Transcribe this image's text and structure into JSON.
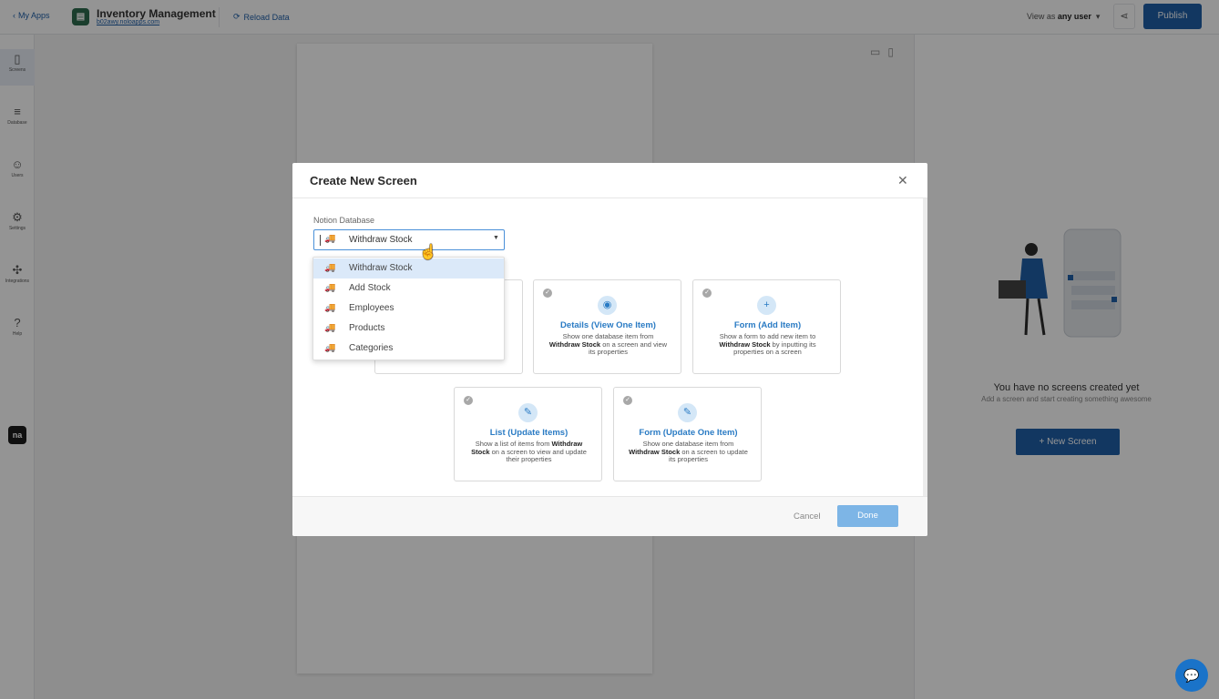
{
  "topbar": {
    "back_label": "My Apps",
    "app_title": "Inventory Management",
    "app_url": "b02awy.noloapps.com",
    "reload_label": "Reload Data",
    "view_as_prefix": "View as",
    "view_as_value": "any user",
    "publish_label": "Publish"
  },
  "sidebar": {
    "items": [
      {
        "label": "Screens",
        "icon": "phone-icon"
      },
      {
        "label": "Database",
        "icon": "database-icon"
      },
      {
        "label": "Users",
        "icon": "users-icon"
      },
      {
        "label": "Settings",
        "icon": "gear-icon"
      },
      {
        "label": "Integrations",
        "icon": "puzzle-icon"
      },
      {
        "label": "Help",
        "icon": "help-icon"
      }
    ],
    "logo_text": "na"
  },
  "right_panel": {
    "empty_title": "You have no screens created yet",
    "empty_subtitle": "Add a screen and start creating something awesome",
    "new_screen_label": "+ New Screen"
  },
  "modal": {
    "title": "Create New Screen",
    "field_label": "Notion Database",
    "selected_value": "Withdraw Stock",
    "options": [
      "Withdraw Stock",
      "Add Stock",
      "Employees",
      "Products",
      "Categories"
    ],
    "cards": [
      {
        "title": "Details (View One Item)",
        "desc_pre": "Show one database item from ",
        "desc_bold": "Withdraw Stock",
        "desc_post": " on a screen and view its properties",
        "icon": "eye-icon"
      },
      {
        "title": "Form (Add Item)",
        "desc_pre": "Show a form to add new item to ",
        "desc_bold": "Withdraw Stock",
        "desc_post": " by inputting its properties on a screen",
        "icon": "plus-icon"
      },
      {
        "title": "List (Update Items)",
        "desc_pre": "Show a list of items from ",
        "desc_bold": "Withdraw Stock",
        "desc_post": " on a screen to view and update their properties",
        "icon": "pencil-icon"
      },
      {
        "title": "Form (Update One Item)",
        "desc_pre": "Show one database item from ",
        "desc_bold": "Withdraw Stock",
        "desc_post": " on a screen to update its properties",
        "icon": "pencil-icon"
      }
    ],
    "cancel_label": "Cancel",
    "done_label": "Done"
  },
  "colors": {
    "brand": "#1f5fa8",
    "card_accent": "#2a7bc4",
    "done_button": "#7db5e6"
  }
}
